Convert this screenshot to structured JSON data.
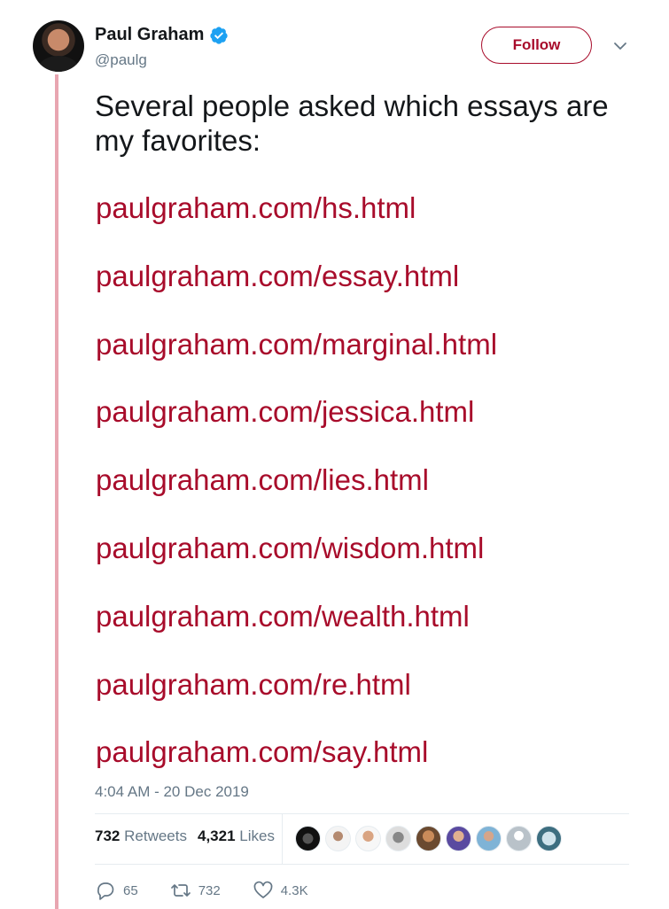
{
  "author": {
    "name": "Paul Graham",
    "handle": "@paulg",
    "verified_icon": "verified-badge-icon"
  },
  "follow_label": "Follow",
  "tweet": {
    "text": "Several people asked which essays are my favorites:",
    "links": [
      "paulgraham.com/hs.html",
      "paulgraham.com/essay.html",
      "paulgraham.com/marginal.html",
      "paulgraham.com/jessica.html",
      "paulgraham.com/lies.html",
      "paulgraham.com/wisdom.html",
      "paulgraham.com/wealth.html",
      "paulgraham.com/re.html",
      "paulgraham.com/say.html"
    ],
    "timestamp": "4:04 AM - 20 Dec 2019"
  },
  "stats": {
    "retweets_count": "732",
    "retweets_label": "Retweets",
    "likes_count": "4,321",
    "likes_label": "Likes"
  },
  "actions": {
    "reply_count": "65",
    "retweet_count": "732",
    "like_count": "4.3K"
  },
  "colors": {
    "link": "#a80c2b",
    "thread_line": "#e8a6b1",
    "secondary_text": "#657786"
  }
}
